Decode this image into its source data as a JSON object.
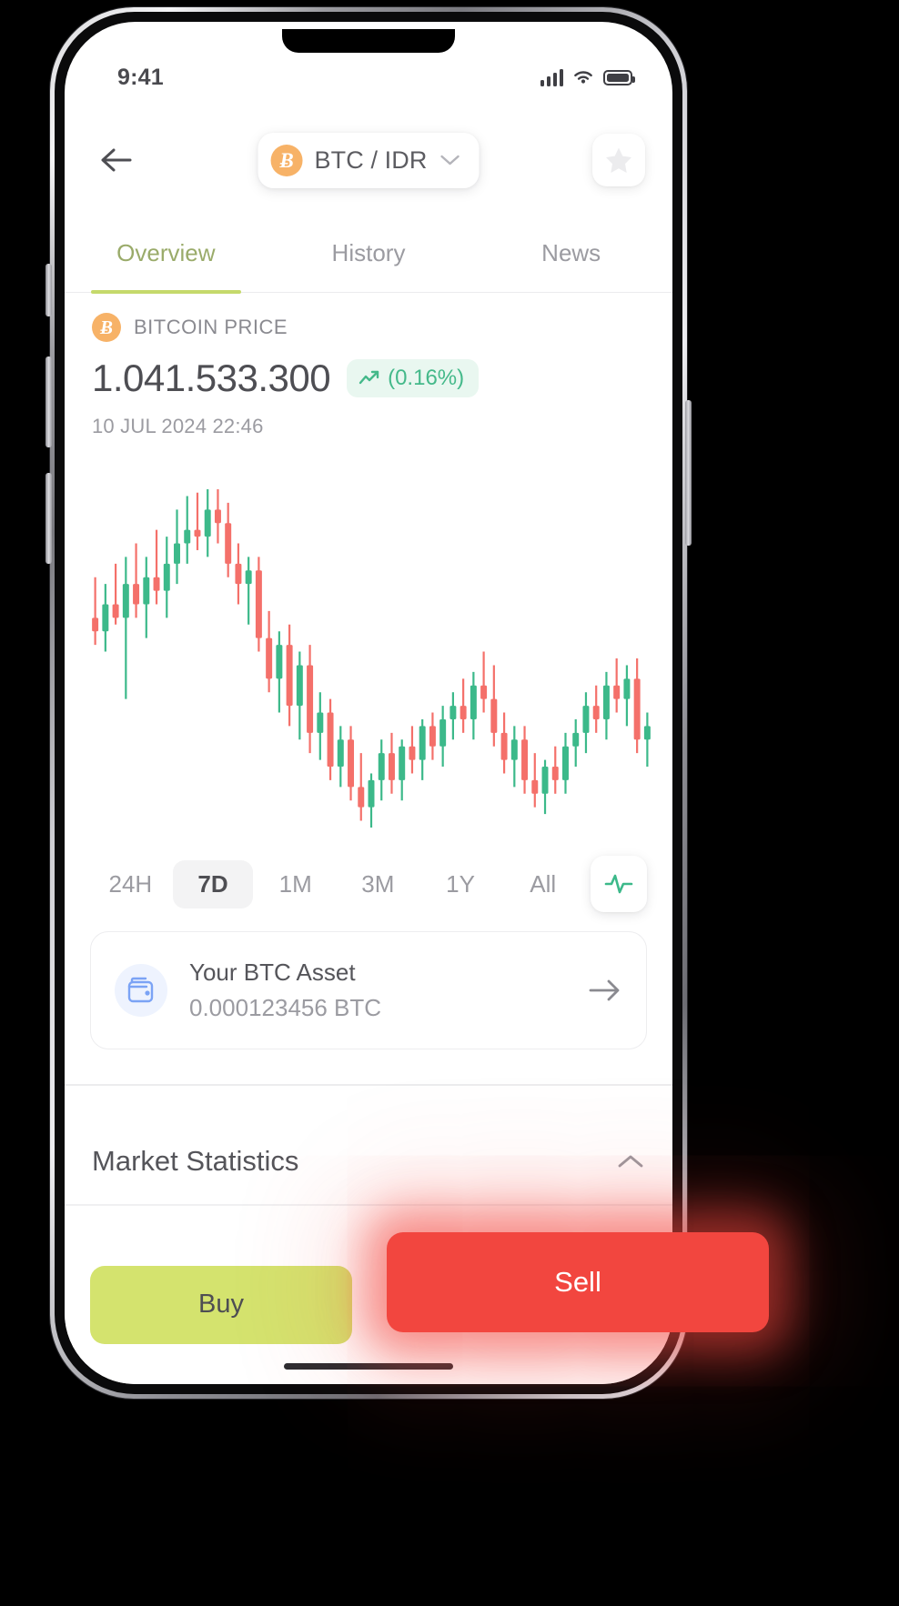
{
  "status_bar": {
    "time": "9:41",
    "icons": [
      "cellular-signal-icon",
      "wifi-icon",
      "battery-icon"
    ]
  },
  "header": {
    "back_icon": "arrow-left-icon",
    "pair_label": "BTC / IDR",
    "coin_symbol": "Ƀ",
    "chevron_icon": "chevron-down-icon",
    "favorite_icon": "star-icon"
  },
  "tabs": [
    {
      "label": "Overview",
      "active": true
    },
    {
      "label": "History",
      "active": false
    },
    {
      "label": "News",
      "active": false
    }
  ],
  "price": {
    "label": "BITCOIN PRICE",
    "coin_symbol": "Ƀ",
    "value": "1.041.533.300",
    "change": "(0.16%)",
    "change_icon": "trend-up-icon",
    "timestamp": "10 JUL 2024 22:46",
    "accent_up": "#44b98a",
    "badge_bg": "#e9f7f0"
  },
  "ranges": [
    {
      "label": "24H",
      "active": false
    },
    {
      "label": "7D",
      "active": true
    },
    {
      "label": "1M",
      "active": false
    },
    {
      "label": "3M",
      "active": false
    },
    {
      "label": "1Y",
      "active": false
    },
    {
      "label": "All",
      "active": false
    }
  ],
  "chart_type_button": {
    "icon": "activity-pulse-icon",
    "color": "#3cb98a"
  },
  "asset_card": {
    "icon": "wallet-icon",
    "title": "Your BTC Asset",
    "amount": "0.000123456 BTC",
    "chevron_icon": "arrow-right-icon"
  },
  "market_statistics": {
    "title": "Market Statistics",
    "toggle_icon": "chevron-up-icon"
  },
  "actions": {
    "buy_label": "Buy",
    "sell_label": "Sell",
    "buy_color": "#d4e36e",
    "sell_color": "#f2463f"
  },
  "chart_data": {
    "type": "candlestick",
    "title": "BTC / IDR price",
    "timeframe": "7D",
    "grid": false,
    "legend": false,
    "up_color": "#3cb98a",
    "down_color": "#f4706a",
    "candles": [
      {
        "o": 62,
        "h": 74,
        "l": 54,
        "c": 58,
        "dir": "down"
      },
      {
        "o": 58,
        "h": 72,
        "l": 52,
        "c": 66,
        "dir": "up"
      },
      {
        "o": 66,
        "h": 78,
        "l": 60,
        "c": 62,
        "dir": "down"
      },
      {
        "o": 62,
        "h": 80,
        "l": 38,
        "c": 72,
        "dir": "up"
      },
      {
        "o": 72,
        "h": 84,
        "l": 62,
        "c": 66,
        "dir": "down"
      },
      {
        "o": 66,
        "h": 80,
        "l": 56,
        "c": 74,
        "dir": "up"
      },
      {
        "o": 74,
        "h": 88,
        "l": 66,
        "c": 70,
        "dir": "down"
      },
      {
        "o": 70,
        "h": 86,
        "l": 62,
        "c": 78,
        "dir": "up"
      },
      {
        "o": 78,
        "h": 94,
        "l": 72,
        "c": 84,
        "dir": "up"
      },
      {
        "o": 84,
        "h": 98,
        "l": 78,
        "c": 88,
        "dir": "up"
      },
      {
        "o": 88,
        "h": 99,
        "l": 82,
        "c": 86,
        "dir": "down"
      },
      {
        "o": 86,
        "h": 100,
        "l": 80,
        "c": 94,
        "dir": "up"
      },
      {
        "o": 94,
        "h": 100,
        "l": 84,
        "c": 90,
        "dir": "down"
      },
      {
        "o": 90,
        "h": 96,
        "l": 74,
        "c": 78,
        "dir": "down"
      },
      {
        "o": 78,
        "h": 84,
        "l": 66,
        "c": 72,
        "dir": "down"
      },
      {
        "o": 72,
        "h": 80,
        "l": 60,
        "c": 76,
        "dir": "up"
      },
      {
        "o": 76,
        "h": 80,
        "l": 52,
        "c": 56,
        "dir": "down"
      },
      {
        "o": 56,
        "h": 64,
        "l": 40,
        "c": 44,
        "dir": "down"
      },
      {
        "o": 44,
        "h": 58,
        "l": 34,
        "c": 54,
        "dir": "up"
      },
      {
        "o": 54,
        "h": 60,
        "l": 30,
        "c": 36,
        "dir": "down"
      },
      {
        "o": 36,
        "h": 52,
        "l": 26,
        "c": 48,
        "dir": "up"
      },
      {
        "o": 48,
        "h": 54,
        "l": 22,
        "c": 28,
        "dir": "down"
      },
      {
        "o": 28,
        "h": 40,
        "l": 20,
        "c": 34,
        "dir": "up"
      },
      {
        "o": 34,
        "h": 38,
        "l": 14,
        "c": 18,
        "dir": "down"
      },
      {
        "o": 18,
        "h": 30,
        "l": 12,
        "c": 26,
        "dir": "up"
      },
      {
        "o": 26,
        "h": 30,
        "l": 8,
        "c": 12,
        "dir": "down"
      },
      {
        "o": 12,
        "h": 22,
        "l": 2,
        "c": 6,
        "dir": "down"
      },
      {
        "o": 6,
        "h": 16,
        "l": 0,
        "c": 14,
        "dir": "up"
      },
      {
        "o": 14,
        "h": 26,
        "l": 8,
        "c": 22,
        "dir": "up"
      },
      {
        "o": 22,
        "h": 28,
        "l": 10,
        "c": 14,
        "dir": "down"
      },
      {
        "o": 14,
        "h": 26,
        "l": 8,
        "c": 24,
        "dir": "up"
      },
      {
        "o": 24,
        "h": 30,
        "l": 16,
        "c": 20,
        "dir": "down"
      },
      {
        "o": 20,
        "h": 32,
        "l": 14,
        "c": 30,
        "dir": "up"
      },
      {
        "o": 30,
        "h": 34,
        "l": 20,
        "c": 24,
        "dir": "down"
      },
      {
        "o": 24,
        "h": 36,
        "l": 18,
        "c": 32,
        "dir": "up"
      },
      {
        "o": 32,
        "h": 40,
        "l": 26,
        "c": 36,
        "dir": "up"
      },
      {
        "o": 36,
        "h": 44,
        "l": 28,
        "c": 32,
        "dir": "down"
      },
      {
        "o": 32,
        "h": 46,
        "l": 26,
        "c": 42,
        "dir": "up"
      },
      {
        "o": 42,
        "h": 52,
        "l": 34,
        "c": 38,
        "dir": "down"
      },
      {
        "o": 38,
        "h": 48,
        "l": 24,
        "c": 28,
        "dir": "down"
      },
      {
        "o": 28,
        "h": 34,
        "l": 16,
        "c": 20,
        "dir": "down"
      },
      {
        "o": 20,
        "h": 30,
        "l": 12,
        "c": 26,
        "dir": "up"
      },
      {
        "o": 26,
        "h": 30,
        "l": 10,
        "c": 14,
        "dir": "down"
      },
      {
        "o": 14,
        "h": 22,
        "l": 6,
        "c": 10,
        "dir": "down"
      },
      {
        "o": 10,
        "h": 20,
        "l": 4,
        "c": 18,
        "dir": "up"
      },
      {
        "o": 18,
        "h": 24,
        "l": 10,
        "c": 14,
        "dir": "down"
      },
      {
        "o": 14,
        "h": 28,
        "l": 10,
        "c": 24,
        "dir": "up"
      },
      {
        "o": 24,
        "h": 32,
        "l": 18,
        "c": 28,
        "dir": "up"
      },
      {
        "o": 28,
        "h": 40,
        "l": 22,
        "c": 36,
        "dir": "up"
      },
      {
        "o": 36,
        "h": 42,
        "l": 28,
        "c": 32,
        "dir": "down"
      },
      {
        "o": 32,
        "h": 46,
        "l": 26,
        "c": 42,
        "dir": "up"
      },
      {
        "o": 42,
        "h": 50,
        "l": 34,
        "c": 38,
        "dir": "down"
      },
      {
        "o": 38,
        "h": 48,
        "l": 30,
        "c": 44,
        "dir": "up"
      },
      {
        "o": 44,
        "h": 50,
        "l": 22,
        "c": 26,
        "dir": "down"
      },
      {
        "o": 26,
        "h": 34,
        "l": 18,
        "c": 30,
        "dir": "up"
      }
    ]
  }
}
